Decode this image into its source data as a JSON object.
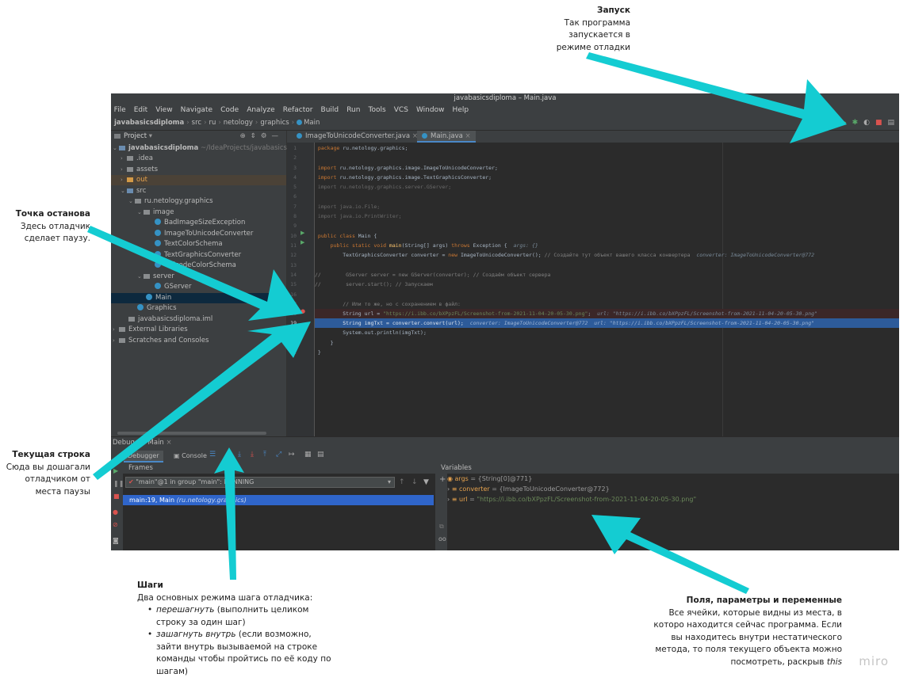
{
  "annotations": {
    "launch": {
      "title": "Запуск",
      "lines": [
        "Так программа",
        "запускается в",
        "режиме отладки"
      ]
    },
    "breakpoint": {
      "title": "Точка останова",
      "lines": [
        "Здесь отладчик",
        "сделает паузу."
      ]
    },
    "current_line": {
      "title": "Текущая строка",
      "lines": [
        "Сюда вы дошагали",
        "отладчиком от",
        "места паузы"
      ]
    },
    "steps": {
      "title": "Шаги",
      "intro": "Два основных режима шага отладчика:",
      "item1_em": "перешагнуть",
      "item1_text": " (выполнить целиком строку за один шаг)",
      "item2_em": "зашагнуть внутрь",
      "item2_text": " (если возможно, зайти внутрь вызываемой на строке команды чтобы пройтись по её коду по шагам)"
    },
    "fields": {
      "title": "Поля, параметры и переменные",
      "lines": [
        "Все ячейки, которые видны из места, в",
        "которо находится сейчас программа. Если",
        "вы находитесь внутри нестатического",
        "метода, то поля текущего объекта можно"
      ],
      "last_prefix": "посмотреть, раскрыв ",
      "last_em": "this"
    },
    "watermark": "miro"
  },
  "ide": {
    "title": "javabasicsdiploma – Main.java",
    "menu": [
      "File",
      "Edit",
      "View",
      "Navigate",
      "Code",
      "Analyze",
      "Refactor",
      "Build",
      "Run",
      "Tools",
      "VCS",
      "Window",
      "Help"
    ],
    "breadcrumb": [
      "javabasicsdiploma",
      "src",
      "ru",
      "netology",
      "graphics",
      "Main"
    ],
    "project_header": "Project",
    "tree": {
      "root": "javabasicsdiploma",
      "root_path": "~/IdeaProjects/javabasicsdi",
      "idea": ".idea",
      "assets": "assets",
      "out": "out",
      "src": "src",
      "pkg": "ru.netology.graphics",
      "image": "image",
      "c1": "BadImageSizeException",
      "c2": "ImageToUnicodeConverter",
      "c3": "TextColorSchema",
      "c4": "TextGraphicsConverter",
      "c5": "UnicodeColorSchema",
      "server": "server",
      "c6": "GServer",
      "main": "Main",
      "graphics": "Graphics",
      "iml": "javabasicsdiploma.iml",
      "ext": "External Libraries",
      "scratches": "Scratches and Consoles"
    },
    "tabs": [
      "ImageToUnicodeConverter.java",
      "Main.java"
    ],
    "code": {
      "l1_kw": "package",
      "l1": " ru.netology.graphics;",
      "l3_kw": "import",
      "l3": " ru.netology.graphics.image.ImageToUnicodeConverter;",
      "l4_kw": "import",
      "l4": " ru.netology.graphics.image.TextGraphicsConverter;",
      "l5": "import ru.netology.graphics.server.GServer;",
      "l7": "import java.io.File;",
      "l8": "import java.io.PrintWriter;",
      "l10_kw": "public class",
      "l10": " Main {",
      "l11_kw": "    public static void",
      "l11_fn": " main",
      "l11": "(String[] args) ",
      "l11_kw2": "throws",
      "l11b": " Exception {  ",
      "l11_hint": "args: {}",
      "l12": "        TextGraphicsConverter converter = ",
      "l12_kw": "new",
      "l12b": " ImageToUnicodeConverter(); ",
      "l12_cm": "// Создайте тут объект вашего класса конвертера",
      "l12_hint": "  converter: ImageToUnicodeConverter@772",
      "l14": "//        GServer server = new GServer(converter); // Создаём объект сервера",
      "l15": "//        server.start(); // Запускаем",
      "l17": "        // Или то же, но с сохранением в файл:",
      "l18": "        String url = ",
      "l18_str": "\"https://i.ibb.co/bXPpzFL/Screenshot-from-2021-11-04-20-05-30.png\"",
      "l18b": ";  ",
      "l18_hint": "url: \"https://i.ibb.co/bXPpzFL/Screenshot-from-2021-11-04-20-05-30.png\"",
      "l19": "        String imgTxt = converter.convert(url);  ",
      "l19_hint": "converter: ImageToUnicodeConverter@772  url: \"https://i.ibb.co/bXPpzFL/Screenshot-from-2021-11-04-20-05-30.png\"",
      "l20": "        System.out.println(imgTxt);",
      "l21": "    }",
      "l22": "}"
    },
    "debug": {
      "title": "Debug:",
      "config": "Main",
      "tab_debugger": "Debugger",
      "tab_console": "Console",
      "frames_header": "Frames",
      "variables_header": "Variables",
      "thread": "\"main\"@1 in group \"main\": RUNNING",
      "frame": "main:19, Main",
      "frame_pkg": "(ru.netology.graphics)",
      "vars": [
        {
          "name": "args",
          "value": "{String[0]@771}"
        },
        {
          "name": "converter",
          "value": "{ImageToUnicodeConverter@772}"
        },
        {
          "name": "url",
          "value": "\"https://i.ibb.co/bXPpzFL/Screenshot-from-2021-11-04-20-05-30.png\""
        }
      ],
      "eq": " = "
    }
  },
  "colors": {
    "arrow": "#14ccd2",
    "accent": "#2f65ca"
  }
}
